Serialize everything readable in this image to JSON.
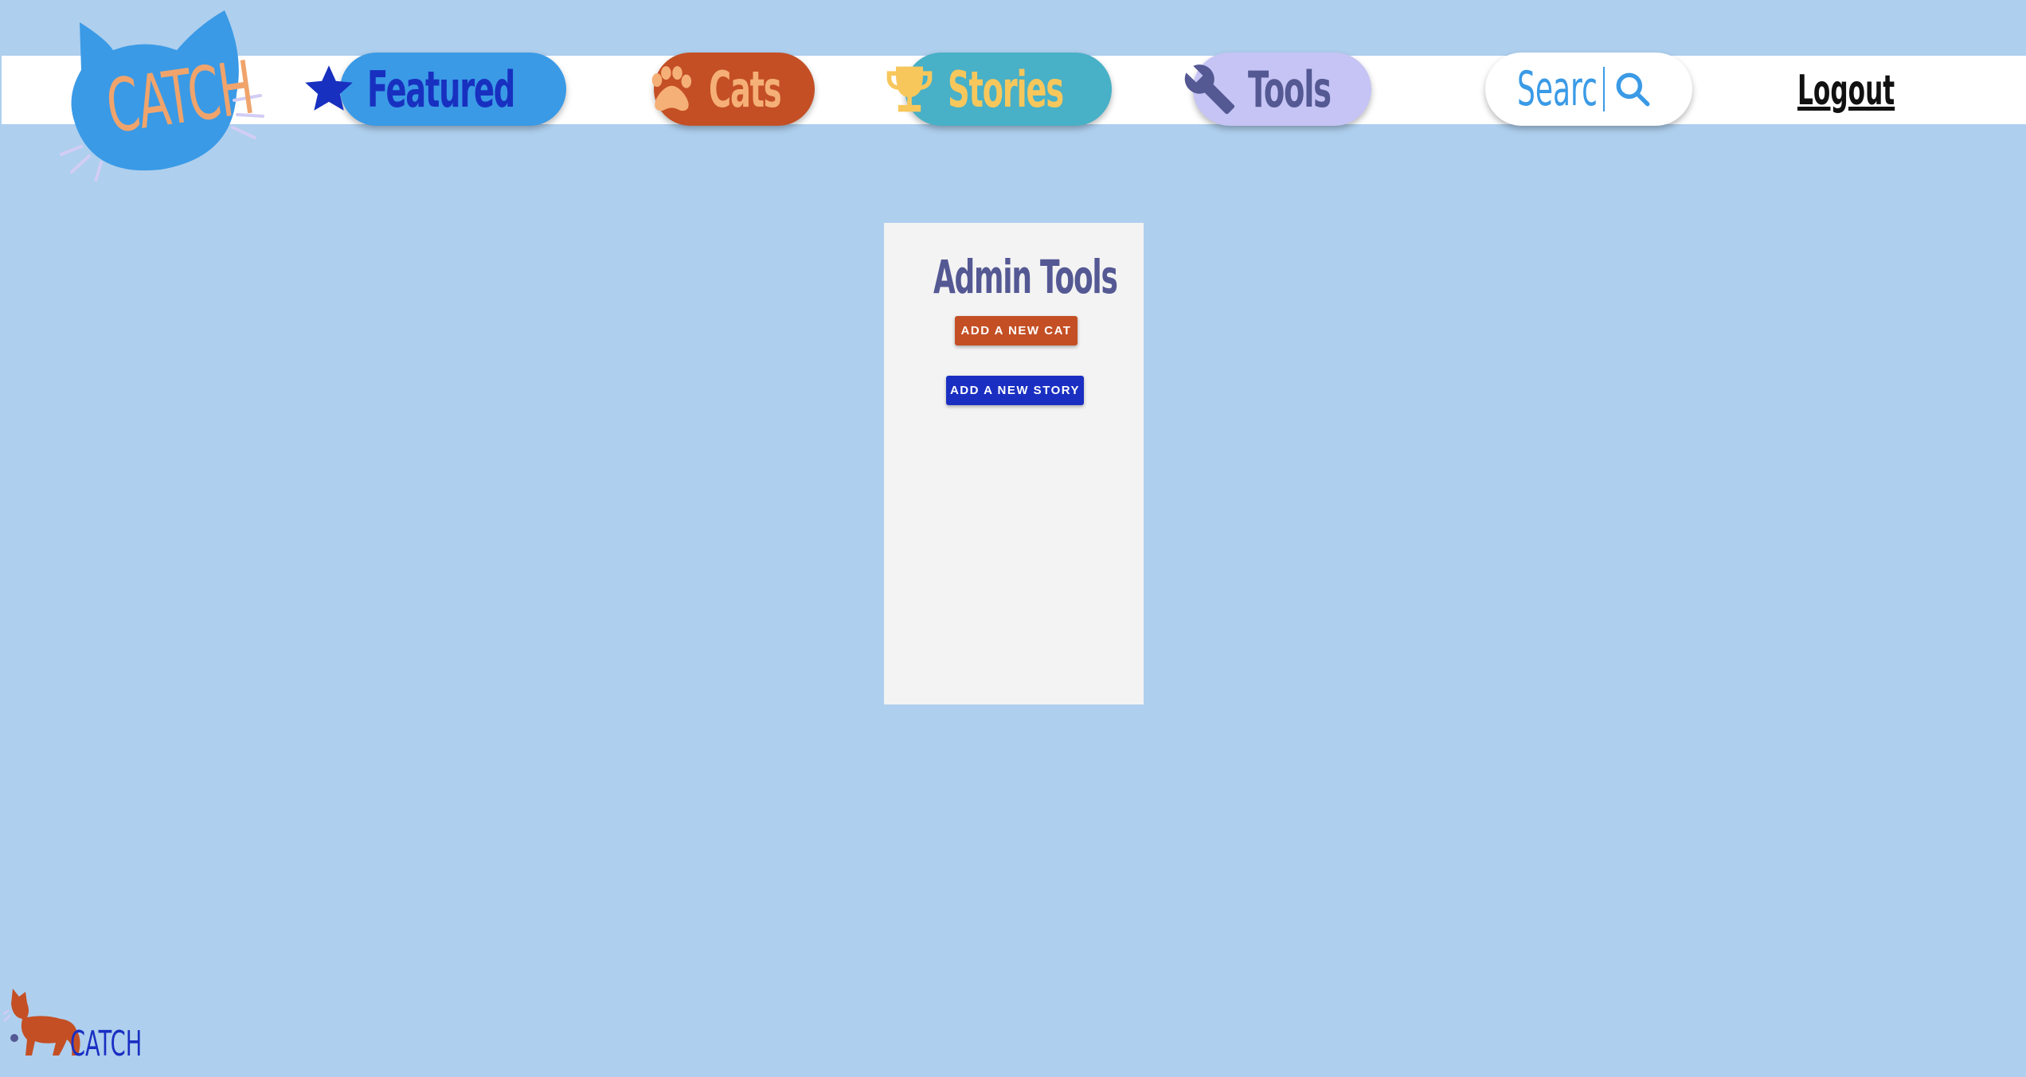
{
  "header": {
    "logo_text": "CATCH",
    "nav": {
      "featured": {
        "label": "Featured",
        "icon": "star-icon"
      },
      "cats": {
        "label": "Cats",
        "icon": "paw-icon"
      },
      "stories": {
        "label": "Stories",
        "icon": "trophy-icon"
      },
      "tools": {
        "label": "Tools",
        "icon": "wrench-icon"
      }
    },
    "search": {
      "placeholder": "Search",
      "icon": "search-icon"
    },
    "logout_label": "Logout"
  },
  "admin_panel": {
    "title": "Admin Tools",
    "add_cat_label": "ADD A NEW CAT",
    "add_story_label": "ADD A NEW STORY"
  },
  "footer": {
    "logo_text": "CATCH"
  },
  "colors": {
    "page_background": "#aecfee",
    "featured_blue": "#3a9ae6",
    "cats_orange": "#c44f24",
    "stories_teal": "#48b0c7",
    "tools_lavender": "#c6c4f4",
    "add_story_blue": "#1a2fc2",
    "panel_background": "#f3f3f3"
  }
}
